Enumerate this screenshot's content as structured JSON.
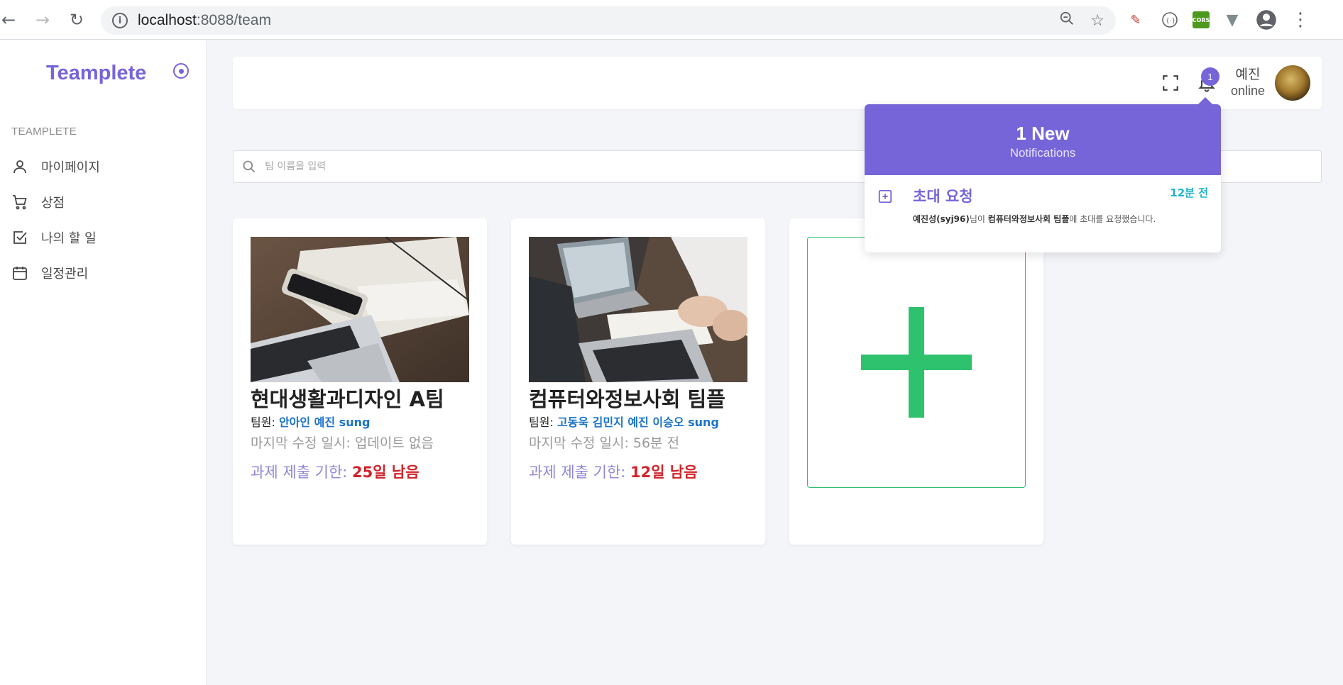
{
  "browser": {
    "url_host": "localhost",
    "url_path": ":8088/team",
    "extension_cors_label": "CORS"
  },
  "sidebar": {
    "brand": "Teamplete",
    "section_heading": "TEAMPLETE",
    "items": [
      {
        "label": "마이페이지",
        "icon": "user-icon"
      },
      {
        "label": "상점",
        "icon": "cart-icon"
      },
      {
        "label": "나의 할 일",
        "icon": "checkbox-icon"
      },
      {
        "label": "일정관리",
        "icon": "calendar-icon"
      }
    ]
  },
  "header": {
    "notification_badge": "1",
    "user_name": "예진",
    "user_status": "online"
  },
  "search": {
    "placeholder": "팀 이름을 입력"
  },
  "teams": [
    {
      "title": "현대생활과디자인 A팀",
      "members_label": "팀원:",
      "members": "안아인 예진 sung",
      "updated": "마지막 수정 일시: 업데이트 없음",
      "deadline_label": "과제 제출 기한:",
      "deadline_days": "25일 남음"
    },
    {
      "title": "컴퓨터와정보사회 팀플",
      "members_label": "팀원:",
      "members": "고동욱 김민지 예진 이승오 sung",
      "updated": "마지막 수정 일시: 56분 전",
      "deadline_label": "과제 제출 기한:",
      "deadline_days": "12일 남음"
    }
  ],
  "notifications": {
    "count_title": "1 New",
    "subtitle": "Notifications",
    "items": [
      {
        "title": "초대 요청",
        "time": "12분 전",
        "sender": "예진성(syj96)",
        "text_1": "님이 ",
        "team": "컴퓨터와정보사회 팀플",
        "text_2": "에 초대를 요청했습니다."
      }
    ]
  },
  "colors": {
    "accent": "#7565d9",
    "add_green": "#2ec26e",
    "deadline_red": "#d2232a",
    "member_blue": "#1a73c8",
    "time_cyan": "#20b4c9"
  }
}
